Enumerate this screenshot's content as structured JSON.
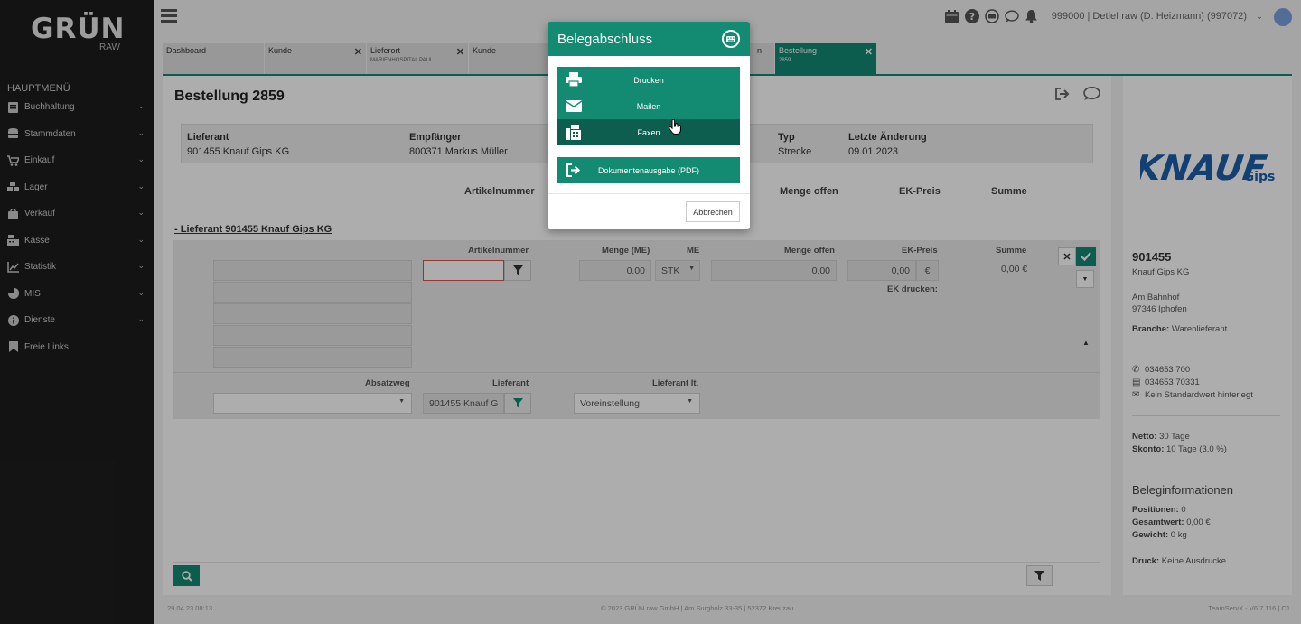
{
  "brand": {
    "logo": "GRÜN",
    "sub": "RAW"
  },
  "sidebar": {
    "title": "HAUPTMENÜ",
    "items": [
      {
        "label": "Buchhaltung",
        "icon": "ledger-icon"
      },
      {
        "label": "Stammdaten",
        "icon": "database-icon"
      },
      {
        "label": "Einkauf",
        "icon": "cart-icon"
      },
      {
        "label": "Lager",
        "icon": "boxes-icon"
      },
      {
        "label": "Verkauf",
        "icon": "bag-icon"
      },
      {
        "label": "Kasse",
        "icon": "cash-register-icon"
      },
      {
        "label": "Statistik",
        "icon": "chart-icon"
      },
      {
        "label": "MIS",
        "icon": "pie-icon"
      },
      {
        "label": "Dienste",
        "icon": "info-icon"
      },
      {
        "label": "Freie Links",
        "icon": "bookmark-icon"
      }
    ]
  },
  "topbar": {
    "user": "999000 | Detlef raw (D. Heizmann) (997072)"
  },
  "tabs": [
    {
      "label": "Dashboard",
      "sub": "",
      "closable": false
    },
    {
      "label": "Kunde",
      "sub": "",
      "closable": true
    },
    {
      "label": "Lieferort",
      "sub": "MARIENHOSPITAL PAUL...",
      "closable": true
    },
    {
      "label": "Kunde",
      "sub": "",
      "closable": false
    },
    {
      "label": "",
      "sub": "",
      "closable": false
    },
    {
      "label": "n",
      "sub": "",
      "closable": true
    },
    {
      "label": "Bestellung",
      "sub": "2859",
      "closable": true,
      "active": true
    }
  ],
  "page": {
    "title": "Bestellung 2859",
    "info": {
      "lieferant_label": "Lieferant",
      "lieferant_value": "901455 Knauf Gips KG",
      "empfaenger_label": "Empfänger",
      "empfaenger_value": "800371 Markus Müller",
      "typ_label": "Typ",
      "typ_value": "Strecke",
      "aenderung_label": "Letzte Änderung",
      "aenderung_value": "09.01.2023"
    },
    "columns": {
      "artikelnummer": "Artikelnummer",
      "menge_offen": "Menge offen",
      "ek_preis": "EK-Preis",
      "summe": "Summe"
    },
    "group_title": "- Lieferant 901455 Knauf Gips KG",
    "row": {
      "artikelnummer_label": "Artikelnummer",
      "menge_label": "Menge (ME)",
      "menge_value": "0.00",
      "me_label": "ME",
      "me_value": "STK",
      "menge_offen_label": "Menge offen",
      "menge_offen_value": "0.00",
      "ek_label": "EK-Preis",
      "ek_value": "0,00",
      "ek_currency": "€",
      "summe_label": "Summe",
      "summe_value": "0,00 €",
      "ek_drucken_label": "EK drucken:",
      "absatzweg_label": "Absatzweg",
      "lieferant_label": "Lieferant",
      "lieferant_value": "901455 Knauf G",
      "lieferant_lt_label": "Lieferant lt.",
      "lieferant_lt_value": "Voreinstellung"
    }
  },
  "right_panel": {
    "logo_main": "KNAUF",
    "logo_sub": "Gips",
    "number": "901455",
    "name": "Knauf Gips KG",
    "street": "Am Bahnhof",
    "city": "97346 Iphofen",
    "branche_label": "Branche:",
    "branche_value": "Warenlieferant",
    "phone": "034653 700",
    "fax": "034653 70331",
    "mail": "Kein Standardwert hinterlegt",
    "netto_label": "Netto:",
    "netto_value": "30 Tage",
    "skonto_label": "Skonto:",
    "skonto_value": "10 Tage (3,0 %)",
    "beleg_title": "Beleginformationen",
    "positionen_label": "Positionen:",
    "positionen_value": "0",
    "gesamt_label": "Gesamtwert:",
    "gesamt_value": "0,00 €",
    "gewicht_label": "Gewicht:",
    "gewicht_value": "0 kg",
    "druck_label": "Druck:",
    "druck_value": "Keine Ausdrucke"
  },
  "footer": {
    "left": "29.04.23 08:13",
    "center": "© 2023 GRÜN raw GmbH | Am Surgholz 33-35 | 52372 Kreuzau",
    "right": "TeamServX - V6.7.116 | C1"
  },
  "modal": {
    "title": "Belegabschluss",
    "buttons": {
      "drucken": "Drucken",
      "mailen": "Mailen",
      "faxen": "Faxen",
      "pdf": "Dokumentenausgabe (PDF)"
    },
    "cancel": "Abbrechen"
  },
  "colors": {
    "accent": "#138a72",
    "accent_dark": "#0d5e4e",
    "sidebar": "#1d1d1d",
    "knauf_blue": "#1b5fa8"
  }
}
